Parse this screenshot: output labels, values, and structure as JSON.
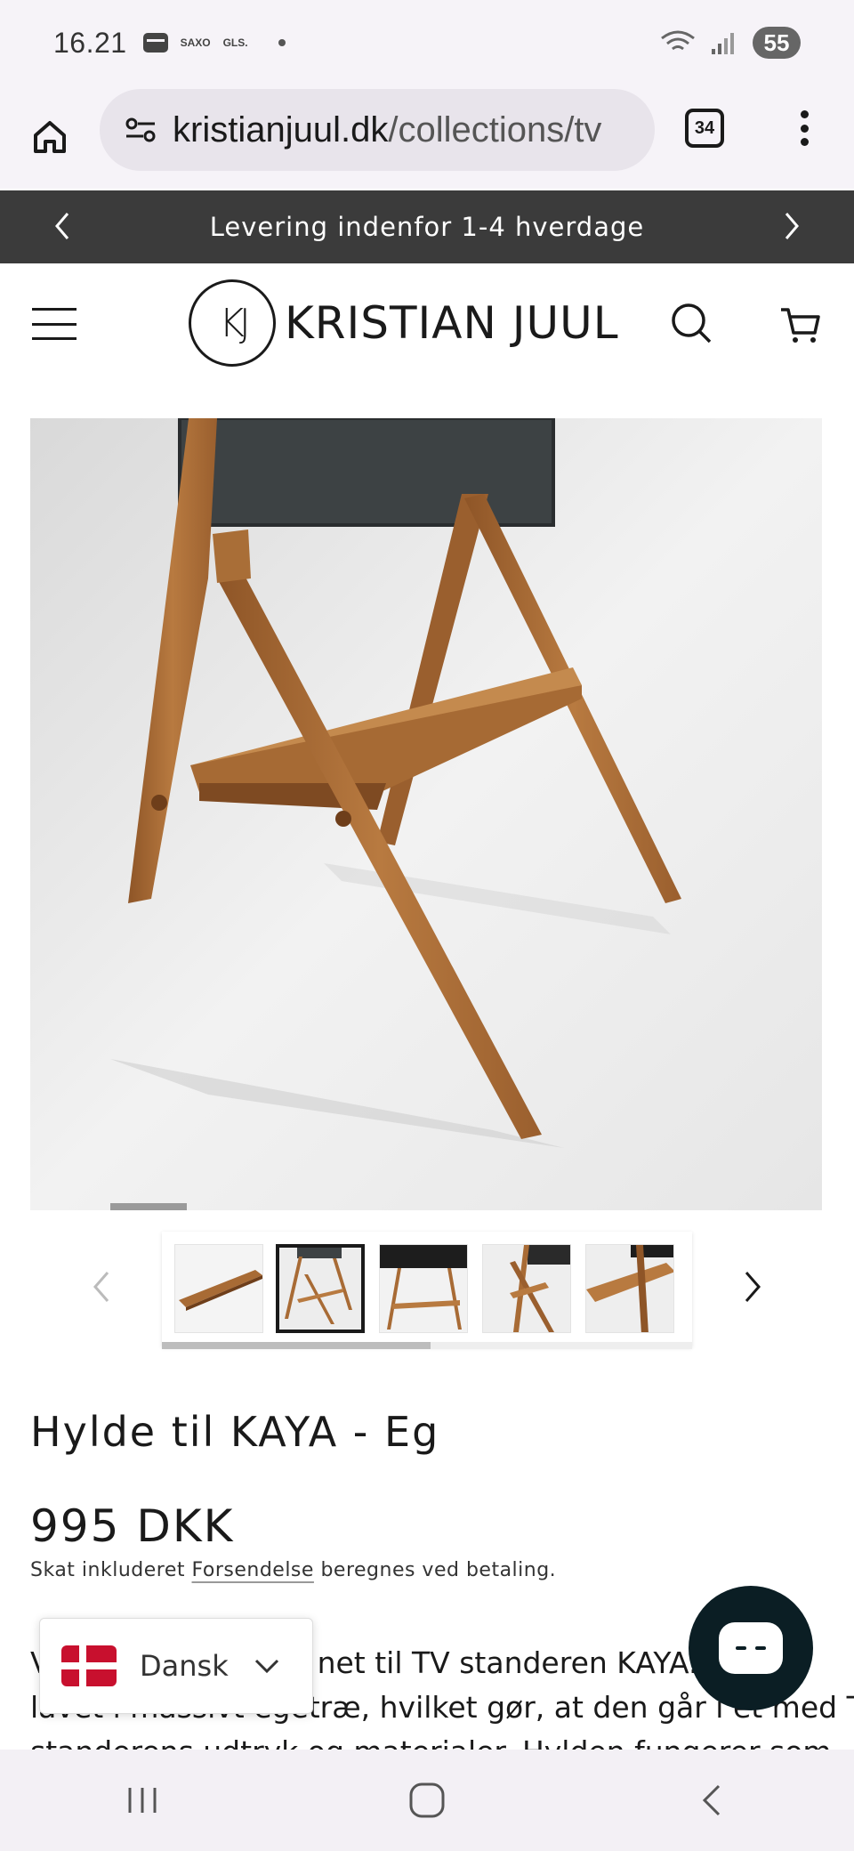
{
  "status_bar": {
    "time": "16.21",
    "notif_1": "SAXO",
    "notif_2": "GLS.",
    "network": "6E",
    "battery": "55"
  },
  "browser": {
    "url_host": "kristianjuul.dk",
    "url_path": "/collections/tv",
    "tab_count": "34"
  },
  "announcement": {
    "text": "Levering indenfor 1-4 hverdage"
  },
  "header": {
    "logo_mark": "KJ",
    "logo_text": "KRISTIAN JUUL"
  },
  "product": {
    "title": "Hylde til KAYA - Eg",
    "price": "995 DKK",
    "tax_prefix": "Skat inkluderet",
    "tax_link": "Forsendelse",
    "tax_suffix": "beregnes ved betaling.",
    "description_line1": "V",
    "description_line1_end": "net til TV standeren KAYA. H",
    "description_line2": "lavet i massivt egetræ, hvilket gør, at den går i et med TV",
    "description_line3": "standerens udtryk og materialer. Hylden fungerer som",
    "thumbnails_count": 5,
    "active_thumbnail": 2
  },
  "language_selector": {
    "label": "Dansk"
  },
  "colors": {
    "announce_bg": "#3b3b3b",
    "chat_bg": "#0b1e24",
    "flag_red": "#c8102e",
    "oak": "#a86b35"
  }
}
